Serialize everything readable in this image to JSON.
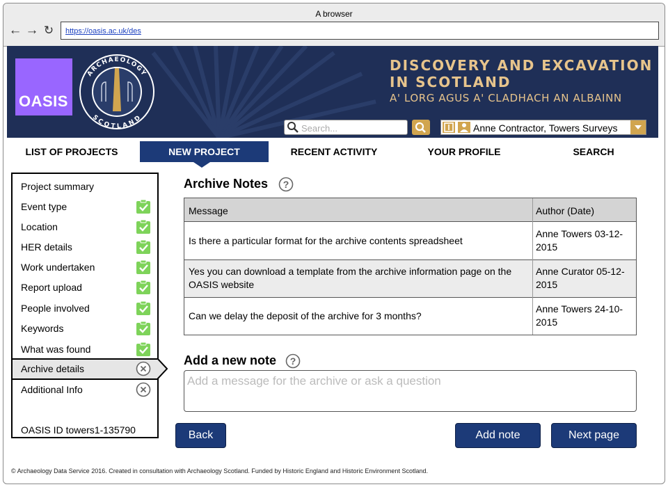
{
  "browser": {
    "title": "A browser",
    "url": "https://oasis.ac.uk/des",
    "back_icon": "arrow-left-icon",
    "forward_icon": "arrow-right-icon",
    "reload_icon": "reload-icon"
  },
  "banner": {
    "oasis_logo_text": "OASIS",
    "seal_top_text": "ARCHAEOLOGY",
    "seal_bottom_text": "SCOTLAND",
    "title_line1": "DISCOVERY AND EXCAVATION",
    "title_line2": "IN SCOTLAND",
    "subtitle": "A' LORG AGUS A' CLADHACH AN ALBAINN",
    "search_placeholder": "Search...",
    "user_name": "Anne Contractor, Towers Surveys",
    "colors": {
      "background": "#1f2f57",
      "gold": "#d1a54f",
      "oasis_purple": "#9966ff",
      "title_text": "#e7c48c"
    }
  },
  "nav": {
    "items": [
      {
        "label": "LIST OF PROJECTS",
        "active": false
      },
      {
        "label": "NEW PROJECT",
        "active": true
      },
      {
        "label": "RECENT ACTIVITY",
        "active": false
      },
      {
        "label": "YOUR PROFILE",
        "active": false
      },
      {
        "label": "SEARCH",
        "active": false
      }
    ],
    "active_color": "#1c3a78"
  },
  "sidebar": {
    "items": [
      {
        "label": "Project summary",
        "status": "none"
      },
      {
        "label": "Event type",
        "status": "complete"
      },
      {
        "label": "Location",
        "status": "complete"
      },
      {
        "label": "HER details",
        "status": "complete"
      },
      {
        "label": "Work undertaken",
        "status": "complete"
      },
      {
        "label": "Report upload",
        "status": "complete"
      },
      {
        "label": "People involved",
        "status": "complete"
      },
      {
        "label": "Keywords",
        "status": "complete"
      },
      {
        "label": "What was found",
        "status": "complete"
      },
      {
        "label": "Archive details",
        "status": "incomplete",
        "current": true
      },
      {
        "label": "Additional Info",
        "status": "incomplete"
      }
    ],
    "oasis_id": "OASIS ID towers1-135790",
    "complete_color": "#7ed35a"
  },
  "archive_notes": {
    "heading": "Archive Notes",
    "columns": [
      "Message",
      "Author (Date)"
    ],
    "rows": [
      {
        "message": "Is there a particular format for the archive contents spreadsheet",
        "author": "Anne Towers 03-12-2015"
      },
      {
        "message": "Yes you can download a template from the archive information page on the OASIS website",
        "author": "Anne Curator 05-12-2015"
      },
      {
        "message": "Can we delay the deposit of the archive for 3 months?",
        "author": "Anne Towers 24-10-2015"
      }
    ]
  },
  "add_note": {
    "heading": "Add a new note",
    "placeholder": "Add a message for the archive or ask a question"
  },
  "buttons": {
    "back": "Back",
    "add_note": "Add note",
    "next_page": "Next page"
  },
  "footer": "© Archaeology Data Service 2016. Created in consultation with Archaeology Scotland. Funded by Historic England and Historic Environment Scotland."
}
